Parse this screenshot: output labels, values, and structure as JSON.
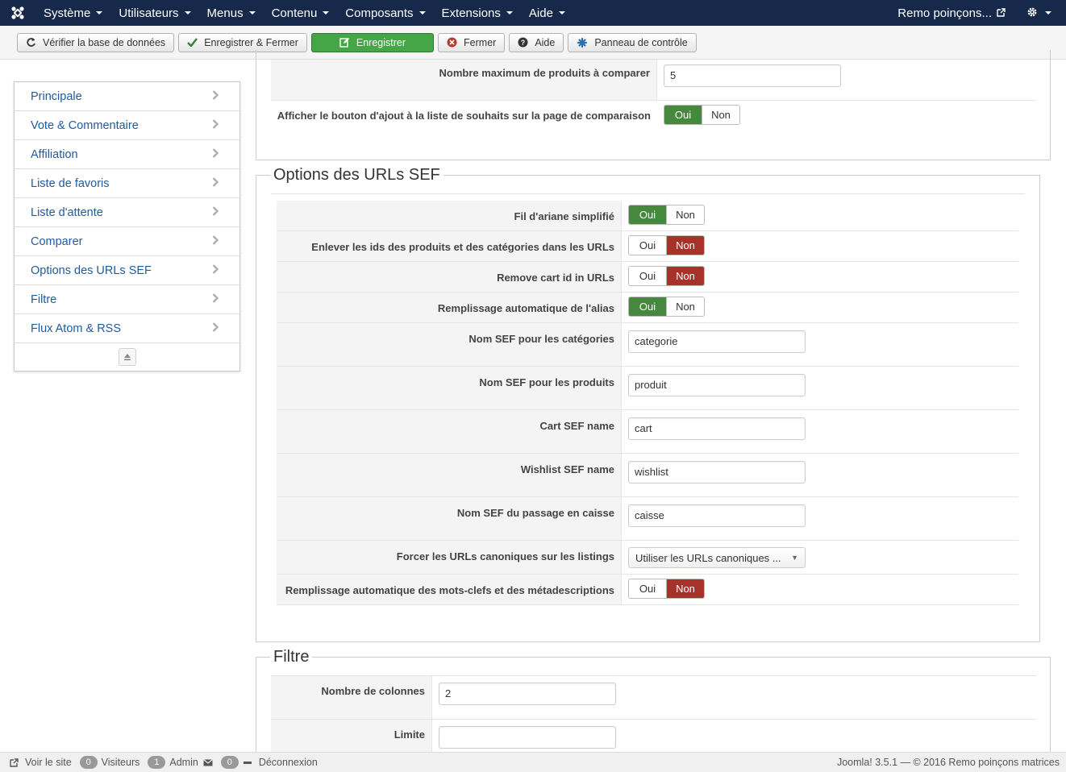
{
  "navbar": {
    "logo_icon": "joomla-logo-icon",
    "menus": [
      "Système",
      "Utilisateurs",
      "Menus",
      "Contenu",
      "Composants",
      "Extensions",
      "Aide"
    ],
    "site_name": "Remo poinçons...",
    "external_icon": "external-link-icon",
    "gear_icon": "gear-icon"
  },
  "toolbar": {
    "check_db": "Vérifier la base de données",
    "save_close": "Enregistrer & Fermer",
    "save": "Enregistrer",
    "close": "Fermer",
    "help": "Aide",
    "control_panel": "Panneau de contrôle"
  },
  "sidebar": {
    "items": [
      {
        "label": "Principale"
      },
      {
        "label": "Vote & Commentaire"
      },
      {
        "label": "Affiliation"
      },
      {
        "label": "Liste de favoris"
      },
      {
        "label": "Liste d'attente"
      },
      {
        "label": "Comparer"
      },
      {
        "label": "Options des URLs SEF"
      },
      {
        "label": "Filtre"
      },
      {
        "label": "Flux Atom & RSS"
      }
    ]
  },
  "compare_section": {
    "max_products_label": "Nombre maximum de produits à comparer",
    "max_products_value": "5",
    "wishlist_button_label": "Afficher le bouton d'ajout à la liste de souhaits sur la page de comparaison",
    "wishlist_button_value": "Oui"
  },
  "sef_section": {
    "legend": "Options des URLs SEF",
    "yes": "Oui",
    "no": "Non",
    "breadcrumb_label": "Fil d'ariane simplifié",
    "breadcrumb_value": "Oui",
    "remove_ids_label": "Enlever les ids des produits et des catégories dans les URLs",
    "remove_ids_value": "Non",
    "remove_cart_label": "Remove cart id in URLs",
    "remove_cart_value": "Non",
    "alias_label": "Remplissage automatique de l'alias",
    "alias_value": "Oui",
    "cat_sef_label": "Nom SEF pour les catégories",
    "cat_sef_value": "categorie",
    "prod_sef_label": "Nom SEF pour les produits",
    "prod_sef_value": "produit",
    "cart_sef_label": "Cart SEF name",
    "cart_sef_value": "cart",
    "wishlist_sef_label": "Wishlist SEF name",
    "wishlist_sef_value": "wishlist",
    "checkout_sef_label": "Nom SEF du passage en caisse",
    "checkout_sef_value": "caisse",
    "canonical_label": "Forcer les URLs canoniques sur les listings",
    "canonical_value": "Utiliser les URLs canoniques ...",
    "meta_label": "Remplissage automatique des mots-clefs et des métadescriptions",
    "meta_value": "Non"
  },
  "filter_section": {
    "legend": "Filtre",
    "columns_label": "Nombre de colonnes",
    "columns_value": "2",
    "limit_label": "Limite",
    "limit_value": ""
  },
  "statusbar": {
    "view_site": "Voir le site",
    "visitors_count": "0",
    "visitors": "Visiteurs",
    "admin_count": "1",
    "admin": "Admin",
    "messages_count": "0",
    "logout": "Déconnexion",
    "version": "Joomla! 3.5.1  —  © 2016 Remo poinçons matrices"
  }
}
